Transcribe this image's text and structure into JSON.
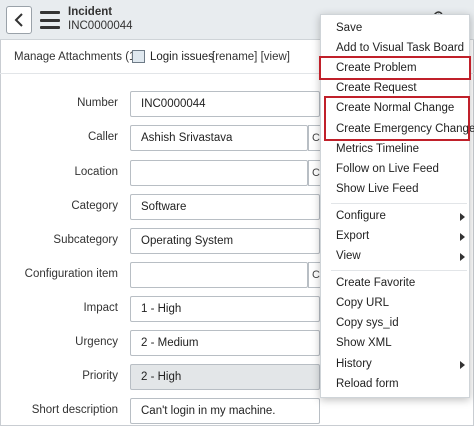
{
  "header": {
    "record_type": "Incident",
    "record_number": "INC0000044",
    "back_icon": "chevron-left-icon",
    "menu_icon": "hamburger-icon",
    "paperclip_icon": "paperclip-icon"
  },
  "attachments": {
    "label": "Manage Attachments (1):",
    "file_icon": "image-file-icon",
    "file_name": "Login issues",
    "links": "[rename] [view]"
  },
  "form": {
    "number": {
      "label": "Number",
      "value": "INC0000044"
    },
    "caller": {
      "label": "Caller",
      "value": "Ashish Srivastava",
      "side": "C"
    },
    "location": {
      "label": "Location",
      "value": "",
      "side": "C"
    },
    "category": {
      "label": "Category",
      "value": "Software"
    },
    "subcategory": {
      "label": "Subcategory",
      "value": "Operating System"
    },
    "configuration_item": {
      "label": "Configuration item",
      "value": "",
      "side": "C"
    },
    "impact": {
      "label": "Impact",
      "value": "1 - High"
    },
    "urgency": {
      "label": "Urgency",
      "value": "2 - Medium"
    },
    "priority": {
      "label": "Priority",
      "value": "2 - High"
    },
    "short_description": {
      "label": "Short description",
      "value": "Can't login in my machine."
    }
  },
  "context_menu": {
    "items": [
      "Save",
      "Add to Visual Task Board",
      "Create Problem",
      "Create Request",
      "Create Normal Change",
      "Create Emergency Change",
      "Metrics Timeline",
      "Follow on Live Feed",
      "Show Live Feed",
      "Configure",
      "Export",
      "View",
      "Create Favorite",
      "Copy URL",
      "Copy sys_id",
      "Show XML",
      "History",
      "Reload form"
    ],
    "submenu_arrow_icon": "chevron-right-icon"
  },
  "colors": {
    "highlight": "#c0202a",
    "header_bg": "#e8ecef",
    "readonly_bg": "#e3e6e8"
  }
}
